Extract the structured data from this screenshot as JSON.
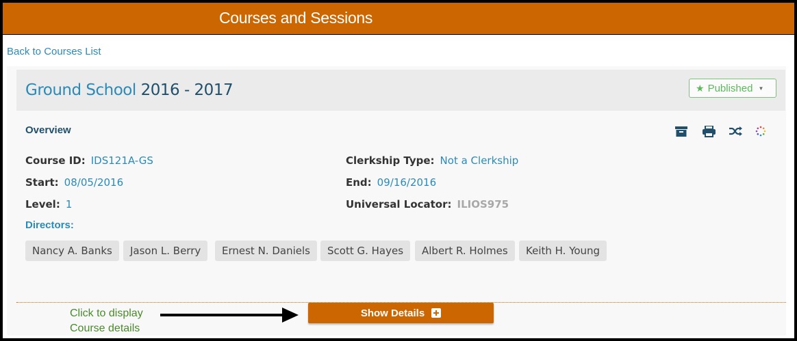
{
  "header": {
    "title": "Courses and Sessions"
  },
  "nav": {
    "back_link": "Back to Courses List"
  },
  "course": {
    "name": "Ground School",
    "year": "2016 - 2017",
    "status": "Published"
  },
  "overview": {
    "label": "Overview",
    "fields": {
      "course_id": {
        "label": "Course ID:",
        "value": "IDS121A-GS"
      },
      "start": {
        "label": "Start:",
        "value": "08/05/2016"
      },
      "level": {
        "label": "Level:",
        "value": "1"
      },
      "clerkship_type": {
        "label": "Clerkship Type:",
        "value": "Not a Clerkship"
      },
      "end": {
        "label": "End:",
        "value": "09/16/2016"
      },
      "universal_locator": {
        "label": "Universal Locator:",
        "value": "ILIOS975"
      }
    },
    "directors_label": "Directors:",
    "directors": [
      "Nancy A. Banks",
      "Jason L. Berry",
      "Ernest N. Daniels",
      "Scott G. Hayes",
      "Albert R. Holmes",
      "Keith H. Young"
    ],
    "actions": [
      "archive-icon",
      "print-icon",
      "shuffle-icon",
      "loading-spinner-icon"
    ]
  },
  "annotation": {
    "line1": "Click to display",
    "line2": "Course details"
  },
  "show_details": {
    "label": "Show Details"
  },
  "colors": {
    "brand": "#cc6600",
    "link": "#2a8ab8",
    "title_dark": "#1f4f6b",
    "published": "#5cb85c",
    "annotation": "#4a8a2a"
  }
}
